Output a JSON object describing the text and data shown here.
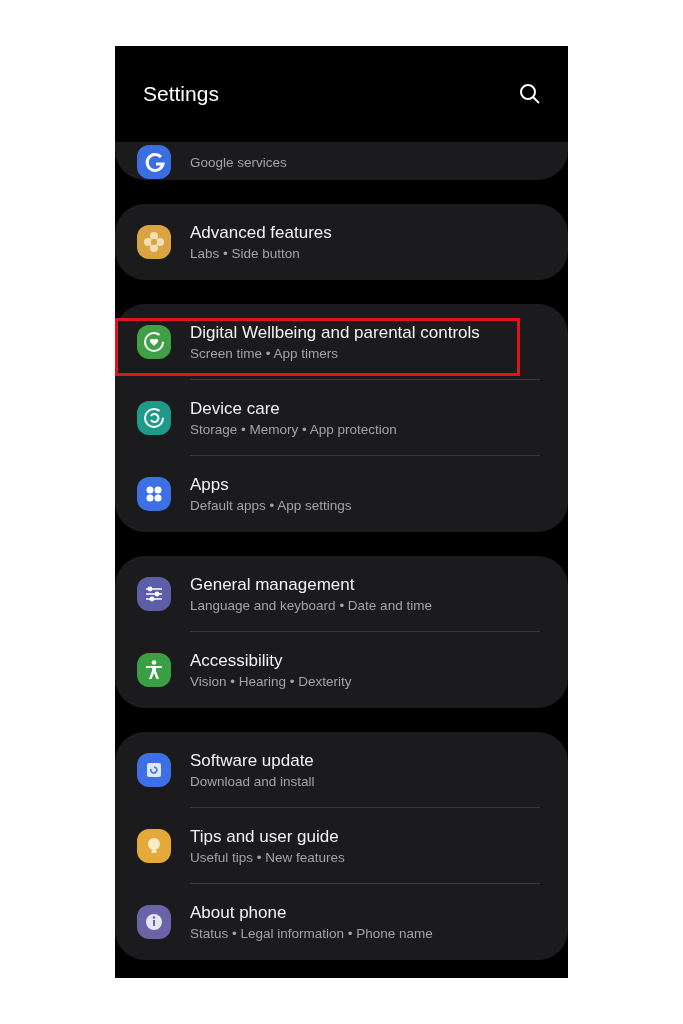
{
  "header": {
    "title": "Settings"
  },
  "groups": [
    {
      "cut": true,
      "items": [
        {
          "kind": "google",
          "color": "#3b6fe0",
          "subtitle": "Google services",
          "highlighted": false
        }
      ]
    },
    {
      "cut": false,
      "items": [
        {
          "kind": "flower",
          "color": "#d9a441",
          "title": "Advanced features",
          "subtitle": "Labs • Side button",
          "highlighted": false
        }
      ]
    },
    {
      "cut": false,
      "items": [
        {
          "kind": "wellbeing",
          "color": "#3fa046",
          "title": "Digital Wellbeing and parental controls",
          "subtitle": "Screen time • App timers",
          "highlighted": true
        },
        {
          "kind": "care",
          "color": "#1f9a8a",
          "title": "Device care",
          "subtitle": "Storage • Memory • App protection",
          "highlighted": false
        },
        {
          "kind": "apps",
          "color": "#3d6fe5",
          "title": "Apps",
          "subtitle": "Default apps • App settings",
          "highlighted": false
        }
      ]
    },
    {
      "cut": false,
      "items": [
        {
          "kind": "management",
          "color": "#5e5ea8",
          "title": "General management",
          "subtitle": "Language and keyboard • Date and time",
          "highlighted": false
        },
        {
          "kind": "accessibility",
          "color": "#3aa043",
          "title": "Accessibility",
          "subtitle": "Vision • Hearing • Dexterity",
          "highlighted": false
        }
      ]
    },
    {
      "cut": false,
      "items": [
        {
          "kind": "update",
          "color": "#3d6fe5",
          "title": "Software update",
          "subtitle": "Download and install",
          "highlighted": false
        },
        {
          "kind": "tips",
          "color": "#e5a93a",
          "title": "Tips and user guide",
          "subtitle": "Useful tips • New features",
          "highlighted": false
        },
        {
          "kind": "about",
          "color": "#6a63a8",
          "title": "About phone",
          "subtitle": "Status • Legal information • Phone name",
          "highlighted": false
        }
      ]
    }
  ]
}
